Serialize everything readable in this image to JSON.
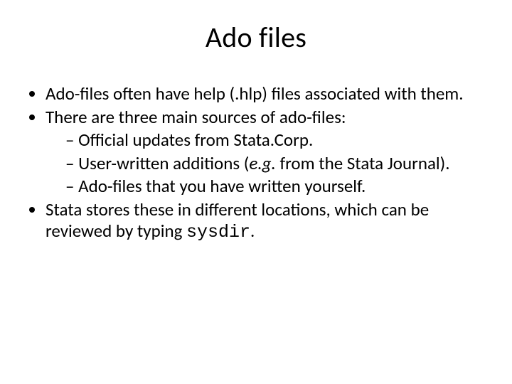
{
  "title": "Ado files",
  "bullets": {
    "b1": "Ado-files often have help (.hlp) files associated with them.",
    "b2": "There are three main sources of ado-files:",
    "b2_sub": {
      "s1": "Official updates from Stata.Corp.",
      "s2_pre": "User-written additions (",
      "s2_eg": "e.g.",
      "s2_post": " from the Stata Journal).",
      "s3": "Ado-files that you have written yourself."
    },
    "b3_pre": "Stata stores these in different locations, which can be reviewed by typing ",
    "b3_code": "sysdir",
    "b3_post": "."
  }
}
